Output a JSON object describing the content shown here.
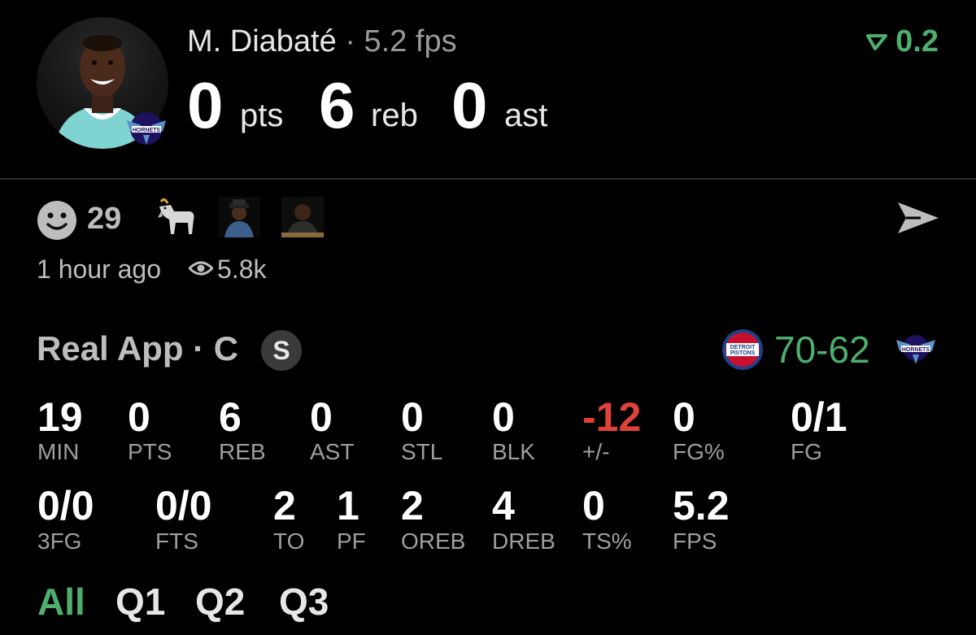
{
  "player": {
    "name": "M. Diabaté",
    "separator": "·",
    "fps": "5.2 fps",
    "trend": "0.2",
    "trend_icon": "trend-down-arrow-icon",
    "stats": [
      {
        "value": "0",
        "unit": "pts"
      },
      {
        "value": "6",
        "unit": "reb"
      },
      {
        "value": "0",
        "unit": "ast"
      }
    ]
  },
  "reactions": {
    "count": "29",
    "icons": [
      "smiley-icon",
      "goat-icon",
      "sticker-1",
      "sticker-2"
    ],
    "timestamp": "1 hour ago",
    "views": "5.8k"
  },
  "game": {
    "source": "Real App · C",
    "badge": "S",
    "score_home": "70",
    "score_dash": "-",
    "score_away": "62",
    "colors": {
      "green": "#4caf6e",
      "red": "#e0413a",
      "pistons": "#c8102e",
      "hornets": "#1d1160"
    }
  },
  "stats_row1": [
    {
      "value": "19",
      "label": "MIN"
    },
    {
      "value": "0",
      "label": "PTS"
    },
    {
      "value": "6",
      "label": "REB"
    },
    {
      "value": "0",
      "label": "AST"
    },
    {
      "value": "0",
      "label": "STL"
    },
    {
      "value": "0",
      "label": "BLK"
    },
    {
      "value": "-12",
      "label": "+/-"
    },
    {
      "value": "0",
      "label": "FG%"
    },
    {
      "value": "0/1",
      "label": "FG"
    }
  ],
  "stats_row2": [
    {
      "value": "0/0",
      "label": "3FG"
    },
    {
      "value": "0/0",
      "label": "FTS"
    },
    {
      "value": "2",
      "label": "TO"
    },
    {
      "value": "1",
      "label": "PF"
    },
    {
      "value": "2",
      "label": "OREB"
    },
    {
      "value": "4",
      "label": "DREB"
    },
    {
      "value": "0",
      "label": "TS%"
    },
    {
      "value": "5.2",
      "label": "FPS"
    }
  ],
  "tabs": [
    {
      "label": "All",
      "active": true
    },
    {
      "label": "Q1",
      "active": false
    },
    {
      "label": "Q2",
      "active": false
    },
    {
      "label": "Q3",
      "active": false
    }
  ]
}
